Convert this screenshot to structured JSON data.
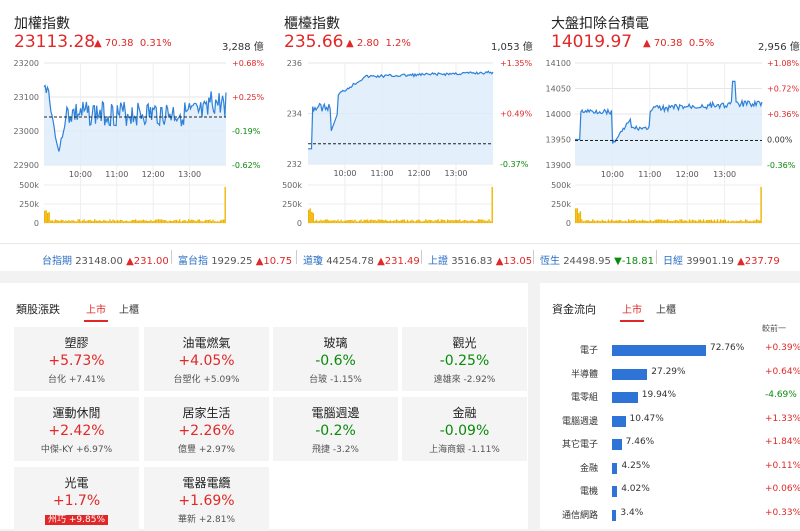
{
  "indices": [
    {
      "name": "加權指數",
      "value": "23113.28",
      "change": "70.38",
      "change_pct": "0.31%",
      "volume": "3,288 億",
      "y_ticks": [
        "23200",
        "23100",
        "23000",
        "22900"
      ],
      "pct_ticks": [
        "+0.68%",
        "+0.25%",
        "-0.19%",
        "-0.62%"
      ],
      "vol_ticks": [
        "500k",
        "250k",
        "0"
      ],
      "x_ticks": [
        "10:00",
        "11:00",
        "12:00",
        "13:00"
      ]
    },
    {
      "name": "櫃檯指數",
      "value": "235.66",
      "change": "2.80",
      "change_pct": "1.2%",
      "volume": "1,053 億",
      "y_ticks": [
        "236",
        "234",
        "232"
      ],
      "pct_ticks": [
        "+1.35%",
        "+0.49%",
        "-0.37%"
      ],
      "vol_ticks": [
        "500k",
        "250k",
        "0"
      ],
      "x_ticks": [
        "10:00",
        "11:00",
        "12:00",
        "13:00"
      ]
    },
    {
      "name": "大盤扣除台積電",
      "value": "14019.97",
      "change": "70.38",
      "change_pct": "0.5%",
      "volume": "2,956 億",
      "y_ticks": [
        "14100",
        "14050",
        "14000",
        "13950",
        "13900"
      ],
      "pct_ticks": [
        "+1.08%",
        "+0.72%",
        "+0.36%",
        "0.00%",
        "-0.36%"
      ],
      "vol_ticks": [
        "500k",
        "250k",
        "0"
      ],
      "x_ticks": [
        "10:00",
        "11:00",
        "12:00",
        "13:00"
      ]
    }
  ],
  "ticker": [
    {
      "name": "台指期",
      "value": "23148.00",
      "change": "▲231.00",
      "dir": "up"
    },
    {
      "name": "富台指",
      "value": "1929.25",
      "change": "▲10.75",
      "dir": "up"
    },
    {
      "name": "道瓊",
      "value": "44254.78",
      "change": "▲231.49",
      "dir": "up"
    },
    {
      "name": "上證",
      "value": "3516.83",
      "change": "▲13.05",
      "dir": "up"
    },
    {
      "name": "恆生",
      "value": "24498.95",
      "change": "▼-18.81",
      "dir": "down"
    },
    {
      "name": "日經",
      "value": "39901.19",
      "change": "▲237.79",
      "dir": "up"
    }
  ],
  "sectors": {
    "title": "類股漲跌",
    "tabs": [
      "上市",
      "上櫃"
    ],
    "cards": [
      {
        "name": "塑膠",
        "pct": "+5.73%",
        "dir": "up",
        "stock": "台化",
        "stock_pct": "+7.41%"
      },
      {
        "name": "油電燃氣",
        "pct": "+4.05%",
        "dir": "up",
        "stock": "台塑化",
        "stock_pct": "+5.09%"
      },
      {
        "name": "玻璃",
        "pct": "-0.6%",
        "dir": "dn",
        "stock": "台玻",
        "stock_pct": "-1.15%"
      },
      {
        "name": "觀光",
        "pct": "-0.25%",
        "dir": "dn",
        "stock": "遠雄來",
        "stock_pct": "-2.92%"
      },
      {
        "name": "運動休閒",
        "pct": "+2.42%",
        "dir": "up",
        "stock": "中傑-KY",
        "stock_pct": "+6.97%"
      },
      {
        "name": "居家生活",
        "pct": "+2.26%",
        "dir": "up",
        "stock": "億豐",
        "stock_pct": "+2.97%"
      },
      {
        "name": "電腦週邊",
        "pct": "-0.2%",
        "dir": "dn",
        "stock": "飛捷",
        "stock_pct": "-3.2%"
      },
      {
        "name": "金融",
        "pct": "-0.09%",
        "dir": "dn",
        "stock": "上海商銀",
        "stock_pct": "-1.11%"
      },
      {
        "name": "光電",
        "pct": "+1.7%",
        "dir": "up",
        "stock": "州巧",
        "stock_pct": "+9.85%",
        "highlight": true
      },
      {
        "name": "電器電纜",
        "pct": "+1.69%",
        "dir": "up",
        "stock": "華新",
        "stock_pct": "+2.81%"
      }
    ]
  },
  "fund_flow": {
    "title": "資金流向",
    "tabs": [
      "上市",
      "上櫃"
    ],
    "col_header": "較前一",
    "rows": [
      {
        "label": "電子",
        "pct": "72.76%",
        "value": 72.76,
        "change": "+0.39%",
        "dir": "up"
      },
      {
        "label": "半導體",
        "pct": "27.29%",
        "value": 27.29,
        "change": "+0.64%",
        "dir": "up"
      },
      {
        "label": "電零組",
        "pct": "19.94%",
        "value": 19.94,
        "change": "-4.69%",
        "dir": "dn"
      },
      {
        "label": "電腦週邊",
        "pct": "10.47%",
        "value": 10.47,
        "change": "+1.33%",
        "dir": "up"
      },
      {
        "label": "其它電子",
        "pct": "7.46%",
        "value": 7.46,
        "change": "+1.84%",
        "dir": "up"
      },
      {
        "label": "金融",
        "pct": "4.25%",
        "value": 4.25,
        "change": "+0.11%",
        "dir": "up"
      },
      {
        "label": "電機",
        "pct": "4.02%",
        "value": 4.02,
        "change": "+0.06%",
        "dir": "up"
      },
      {
        "label": "通信網路",
        "pct": "3.4%",
        "value": 3.4,
        "change": "+0.33%",
        "dir": "up"
      }
    ]
  },
  "colors": {
    "up": "#e02828",
    "down": "#0a8a0a",
    "line": "#2e80d8",
    "bar": "#f0b400"
  }
}
